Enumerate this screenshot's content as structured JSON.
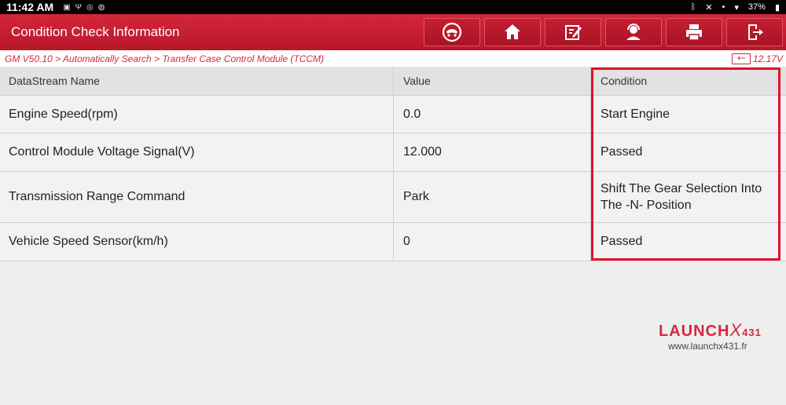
{
  "status_bar": {
    "time": "11:42 AM",
    "battery": "37%"
  },
  "header": {
    "title": "Condition Check Information",
    "toolbar": [
      {
        "name": "diagnose-home-button",
        "icon": "car-steering-icon"
      },
      {
        "name": "home-button",
        "icon": "home-icon"
      },
      {
        "name": "report-button",
        "icon": "edit-report-icon"
      },
      {
        "name": "remote-expert-button",
        "icon": "user-headset-icon"
      },
      {
        "name": "print-button",
        "icon": "printer-icon"
      },
      {
        "name": "exit-button",
        "icon": "exit-icon"
      }
    ]
  },
  "breadcrumb": "GM V50.10 > Automatically Search > Transfer Case Control Module (TCCM)",
  "voltage": "12.17V",
  "table": {
    "headers": [
      "DataStream Name",
      "Value",
      "Condition"
    ],
    "rows": [
      {
        "name": "Engine Speed(rpm)",
        "value": "0.0",
        "condition": "Start Engine"
      },
      {
        "name": "Control Module Voltage Signal(V)",
        "value": "12.000",
        "condition": "Passed"
      },
      {
        "name": "Transmission Range Command",
        "value": "Park",
        "condition": "Shift The Gear Selection Into The -N- Position"
      },
      {
        "name": "Vehicle Speed Sensor(km/h)",
        "value": "0",
        "condition": "Passed"
      }
    ]
  },
  "brand": {
    "logo_main": "LAUNCH",
    "logo_x": "X",
    "logo_num": "431",
    "url": "www.launchx431.fr"
  },
  "colors": {
    "header_red": "#c41e30",
    "accent_red": "#d6283c",
    "highlight_red": "#e0142b"
  }
}
